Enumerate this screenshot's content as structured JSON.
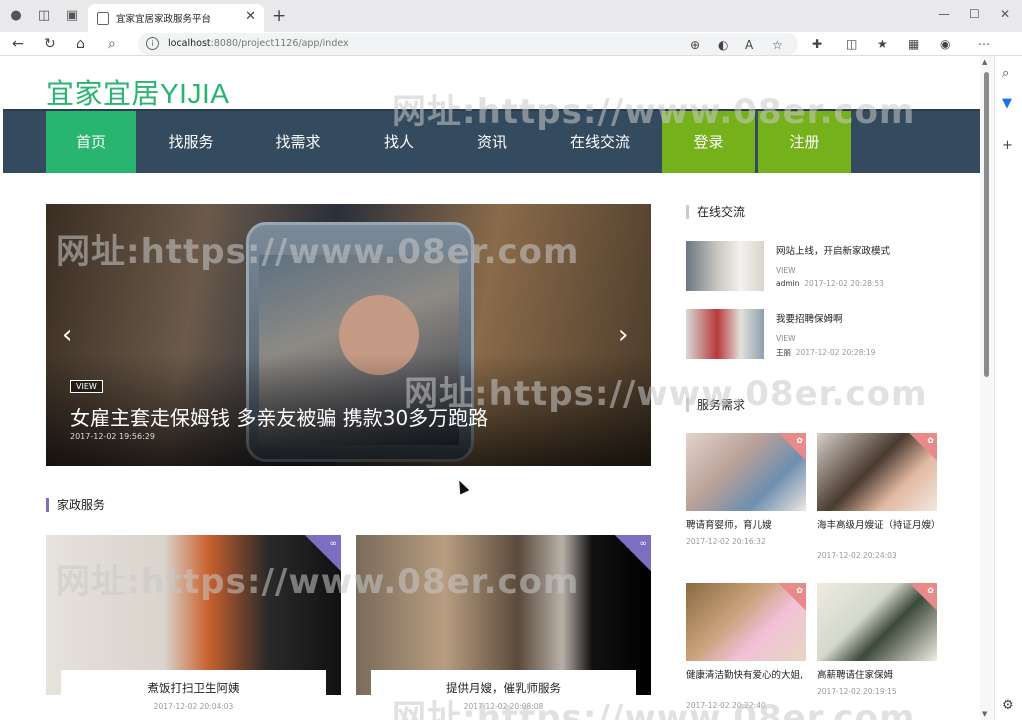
{
  "browser": {
    "tab_title": "宜家宜居家政服务平台",
    "url_host": "localhost",
    "url_rest": ":8080/project1126/app/index"
  },
  "site": {
    "logo": "宜家宜居YIJIA",
    "nav": [
      "首页",
      "找服务",
      "找需求",
      "找人",
      "资讯",
      "在线交流",
      "登录",
      "注册"
    ]
  },
  "watermark": "网址:https://www.08er.com",
  "carousel": {
    "tag": "VIEW",
    "title": "女雇主套走保姆钱 多亲友被骗 携款30多万跑路",
    "date": "2017-12-02 19:56:29"
  },
  "services": {
    "heading": "家政服务",
    "items": [
      {
        "name": "煮饭打扫卫生阿姨",
        "date": "2017-12-02 20:04:03"
      },
      {
        "name": "提供月嫂，催乳师服务",
        "date": "2017-12-02 20:08:08"
      }
    ]
  },
  "chat": {
    "heading": "在线交流",
    "items": [
      {
        "title": "网站上线，开启新家政模式",
        "view": "VIEW",
        "author": "admin",
        "date": "2017-12-02 20:28:53"
      },
      {
        "title": "我要招聘保姆啊",
        "view": "VIEW",
        "author": "王丽",
        "date": "2017-12-02 20:28:19"
      }
    ]
  },
  "needs": {
    "heading": "服务需求",
    "items": [
      {
        "title": "聘请育婴师，育儿嫂",
        "date": "2017-12-02 20:16:32"
      },
      {
        "title": "海丰高级月嫂证（持证月嫂）",
        "date": "2017-12-02 20:24:03"
      },
      {
        "title": "健康清洁勤快有爱心的大姐,",
        "date": "2017-12-02 20:22:40"
      },
      {
        "title": "高薪聘请住家保姆",
        "date": "2017-12-02 20:19:15"
      }
    ]
  },
  "colors": {
    "brand_green": "#27b56f",
    "nav_bg": "#344a5e",
    "login_green": "#74b11b"
  },
  "icons": [
    "profile-icon",
    "workspaces-icon",
    "tab-actions-icon",
    "back-icon",
    "refresh-icon",
    "home-icon",
    "search-icon",
    "info-icon",
    "zoom-icon",
    "translate-icon",
    "read-aloud-icon",
    "favorite-icon",
    "extensions-icon",
    "split-icon",
    "favorites-icon",
    "collections-icon",
    "copilot-icon"
  ]
}
